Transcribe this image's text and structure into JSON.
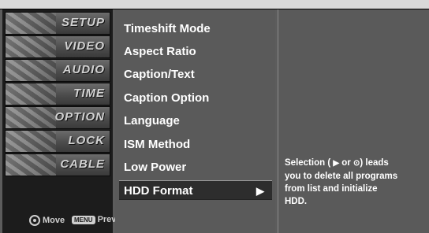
{
  "categories": [
    {
      "label": "SETUP",
      "icon": "setup-icon"
    },
    {
      "label": "VIDEO",
      "icon": "video-icon"
    },
    {
      "label": "AUDIO",
      "icon": "audio-icon"
    },
    {
      "label": "TIME",
      "icon": "time-icon"
    },
    {
      "label": "OPTION",
      "icon": "option-icon"
    },
    {
      "label": "LOCK",
      "icon": "lock-icon"
    },
    {
      "label": "CABLE",
      "icon": "cable-icon"
    }
  ],
  "hints": {
    "move_label": "Move",
    "menu_key": "MENU",
    "prev_label": "Prev"
  },
  "options": [
    "Timeshift Mode",
    "Aspect Ratio",
    "Caption/Text",
    "Caption Option",
    "Language",
    "ISM Method",
    "Low Power",
    "HDD Format"
  ],
  "selected_option": "HDD Format",
  "description": {
    "line1_a": "Selection (",
    "line1_b": "or",
    "line1_c": ") leads",
    "line2": "you  to delete all programs",
    "line3": "from list and initialize",
    "line4": "HDD."
  },
  "glyphs": {
    "arrow": "▶",
    "enter": "⊙"
  }
}
